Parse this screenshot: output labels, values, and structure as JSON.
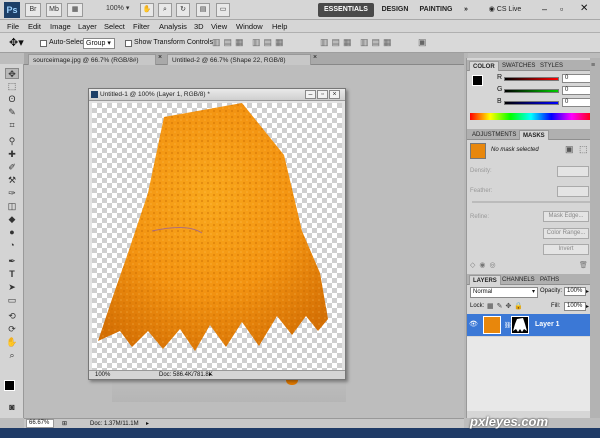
{
  "app": {
    "logo": "Ps",
    "quick_buttons": [
      "Br",
      "Mb"
    ],
    "zoom_select": "100%",
    "workspaces": [
      "ESSENTIALS",
      "DESIGN",
      "PAINTING"
    ],
    "more": "»",
    "cslive": "CS Live"
  },
  "menu": [
    "File",
    "Edit",
    "Image",
    "Layer",
    "Select",
    "Filter",
    "Analysis",
    "3D",
    "View",
    "Window",
    "Help"
  ],
  "options": {
    "auto_select_label": "Auto-Select:",
    "auto_select_value": "Group",
    "show_transform_label": "Show Transform Controls"
  },
  "tabs": [
    {
      "label": "sourceimage.jpg @ 66.7% (RGB/8#)"
    },
    {
      "label": "Untitled-2 @ 66.7% (Shape 22, RGB/8)"
    }
  ],
  "doc": {
    "title": "Untitled-1 @ 100% (Layer 1, RGB/8) *",
    "zoom": "100%",
    "info": "Doc: 586.4K/781.8K"
  },
  "status": {
    "zoom": "66.67%",
    "info": "Doc: 1.37M/11.1M"
  },
  "color_panel": {
    "tabs": [
      "COLOR",
      "SWATCHES",
      "STYLES"
    ],
    "channels": [
      {
        "label": "R",
        "value": "0",
        "color": "#e01010"
      },
      {
        "label": "G",
        "value": "0",
        "color": "#10b020"
      },
      {
        "label": "B",
        "value": "0",
        "color": "#1030e0"
      }
    ]
  },
  "adjust_panel": {
    "tabs": [
      "ADJUSTMENTS",
      "MASKS"
    ],
    "no_mask": "No mask selected",
    "density": "Density:",
    "feather": "Feather:",
    "refine": "Refine:",
    "mask_edge": "Mask Edge...",
    "color_range": "Color Range...",
    "invert": "Invert"
  },
  "layers_panel": {
    "tabs": [
      "LAYERS",
      "CHANNELS",
      "PATHS"
    ],
    "blend_mode": "Normal",
    "opacity_label": "Opacity:",
    "opacity": "100%",
    "lock_label": "Lock:",
    "fill_label": "Fill:",
    "fill": "100%",
    "layer_name": "Layer 1"
  },
  "watermark": "pxleyes.com"
}
